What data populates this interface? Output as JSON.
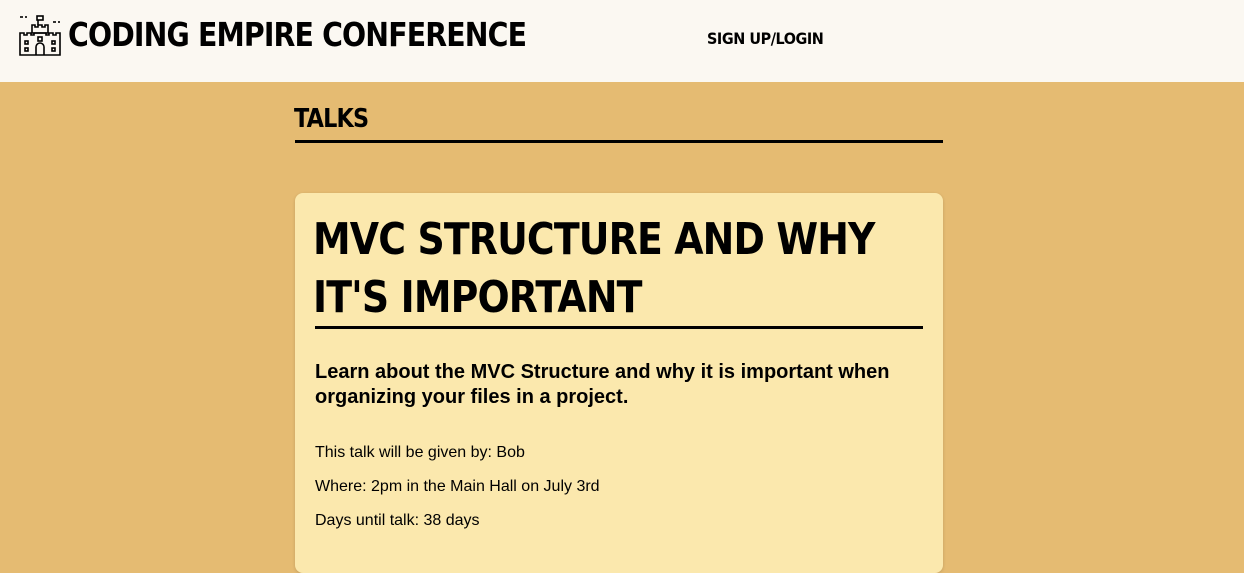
{
  "header": {
    "site_name": "CODING EMPIRE CONFERENCE",
    "logo_icon": "castle-icon",
    "nav_link": "SIGN UP/LOGIN"
  },
  "section": {
    "title": "TALKS"
  },
  "talk": {
    "title": "MVC STRUCTURE AND WHY IT'S IMPORTANT",
    "description": "Learn about the MVC Structure and why it is important when organizing your files in a project.",
    "given_by": "This talk will be given by: Bob",
    "where": "Where: 2pm in the Main Hall on July 3rd",
    "days_until": "Days until talk: 38 days"
  },
  "colors": {
    "page_background": "#e5bb72",
    "header_background": "#fbf8f2",
    "card_background": "#fbe8ad",
    "text": "#000000"
  }
}
